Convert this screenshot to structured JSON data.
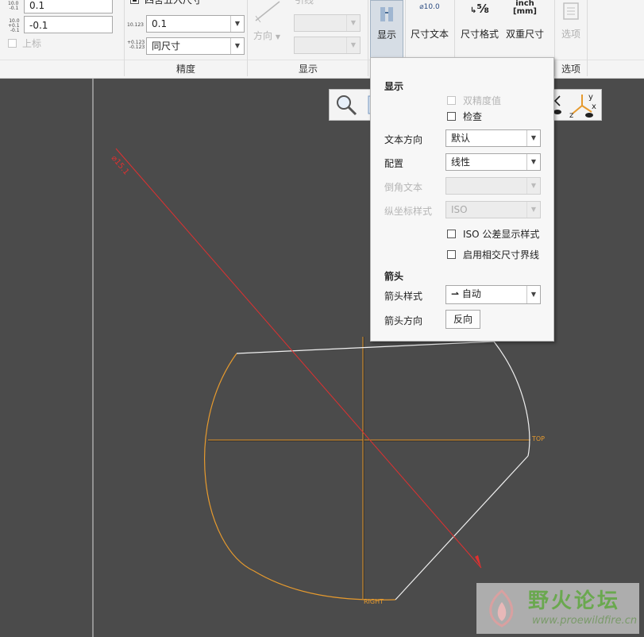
{
  "ribbon": {
    "tolerance": {
      "upper_value": "0.1",
      "lower_value": "-0.1",
      "upper_check_label": "上标",
      "upper_icon_lines": [
        "10.0",
        "-0.1"
      ],
      "lower_icon_lines": [
        "10.0",
        "+0.1",
        "-0.1"
      ]
    },
    "precision": {
      "top_check_label": "四舍五入尺寸",
      "decimal_value": "0.1",
      "decimal_icon": "10.123",
      "tol_value": "同尺寸",
      "tol_icon_lines": [
        "+0.123",
        "-0.123"
      ],
      "group_label": "精度"
    },
    "display_group": {
      "direction_label": "方向",
      "lead_label": "引线",
      "group_label": "显示"
    },
    "buttons": {
      "display": "显示",
      "dim_text": "尺寸文本",
      "dim_text_icon": "⌀10.0",
      "dim_format": "尺寸格式",
      "dim_format_icon": "⅝",
      "dual_dim": "双重尺寸",
      "dual_dim_icon": [
        "inch",
        "[mm]"
      ],
      "options": "选项",
      "options_group_label": "选项"
    }
  },
  "dropdown": {
    "display_header": "显示",
    "dual_precision_label": "双精度值",
    "check_label": "检查",
    "text_dir_label": "文本方向",
    "text_dir_value": "默认",
    "config_label": "配置",
    "config_value": "线性",
    "chamfer_label": "倒角文本",
    "chamfer_value": "",
    "ordinate_label": "纵坐标样式",
    "ordinate_value": "ISO",
    "iso_tol_label": "ISO 公差显示样式",
    "intersect_label": "启用相交尺寸界线",
    "arrow_header": "箭头",
    "arrow_style_label": "箭头样式",
    "arrow_style_value": "自动",
    "arrow_dir_label": "箭头方向",
    "arrow_dir_button": "反向"
  },
  "viewport": {
    "dim_label": "⌀15.1",
    "top_label": "TOP",
    "right_label": "RIGHT",
    "triad_labels": [
      "y",
      "x",
      "z"
    ]
  },
  "watermark": {
    "title": "野火论坛",
    "url": "www.proewildfire.cn"
  },
  "colors": {
    "viewport_bg": "#4b4b4b",
    "datum_orange": "#e69a2e",
    "dimension_red": "#e03030",
    "sketch_white": "#f0f0f0",
    "axis_dark": "#2a2a2a"
  }
}
